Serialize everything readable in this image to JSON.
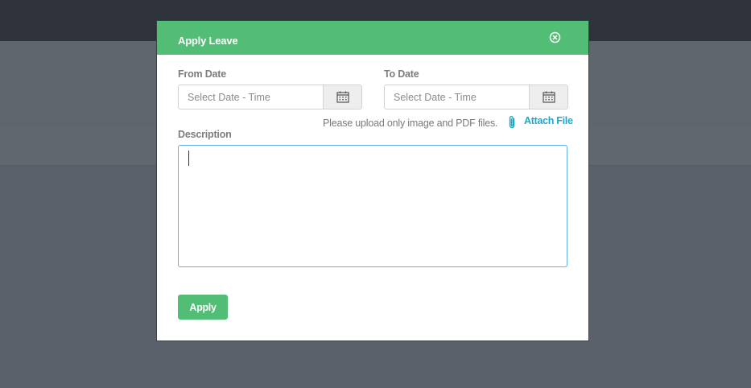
{
  "modal": {
    "title": "Apply Leave",
    "from_date": {
      "label": "From Date",
      "placeholder": "Select Date - Time",
      "value": ""
    },
    "to_date": {
      "label": "To Date",
      "placeholder": "Select Date - Time",
      "value": ""
    },
    "upload_note": "Please upload only image and PDF files.",
    "attach_label": "Attach File",
    "description": {
      "label": "Description",
      "value": ""
    },
    "apply_label": "Apply"
  },
  "icons": {
    "close": "close-circle-icon",
    "calendar": "calendar-icon",
    "attach": "paperclip-icon"
  },
  "colors": {
    "header": "#52be75",
    "apply_button": "#52be75",
    "link": "#1fa9c9",
    "overlay": "#5b616a",
    "topbar": "#2d323b"
  }
}
